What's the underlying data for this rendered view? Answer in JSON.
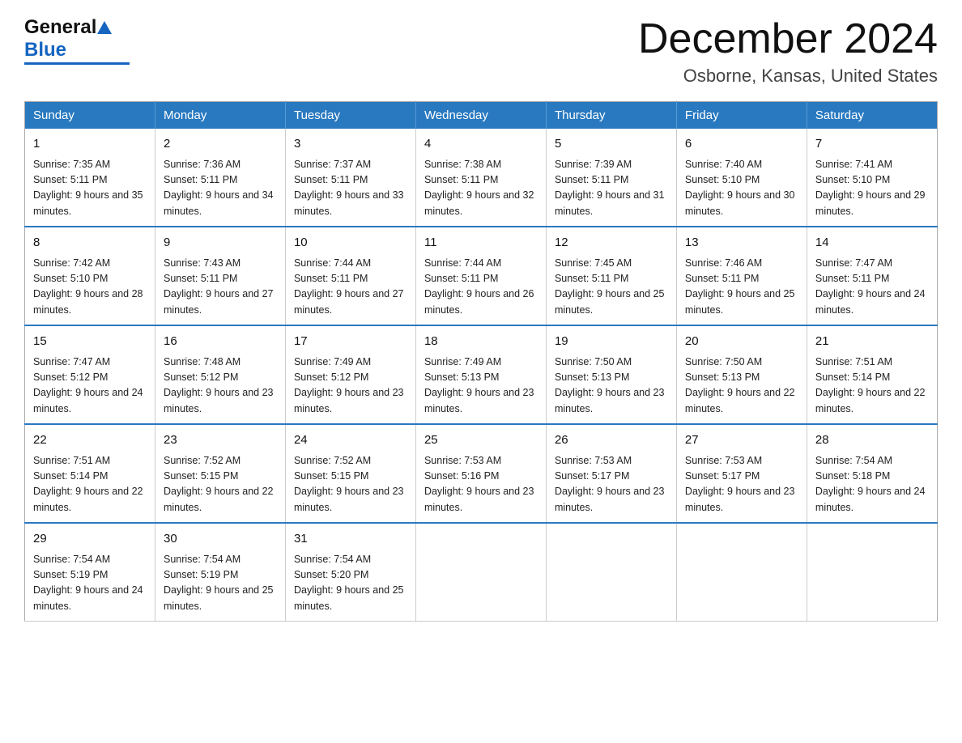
{
  "header": {
    "logo_general": "General",
    "logo_blue": "Blue",
    "month_title": "December 2024",
    "location": "Osborne, Kansas, United States"
  },
  "days_of_week": [
    "Sunday",
    "Monday",
    "Tuesday",
    "Wednesday",
    "Thursday",
    "Friday",
    "Saturday"
  ],
  "weeks": [
    [
      {
        "day": "1",
        "sunrise": "7:35 AM",
        "sunset": "5:11 PM",
        "daylight": "9 hours and 35 minutes."
      },
      {
        "day": "2",
        "sunrise": "7:36 AM",
        "sunset": "5:11 PM",
        "daylight": "9 hours and 34 minutes."
      },
      {
        "day": "3",
        "sunrise": "7:37 AM",
        "sunset": "5:11 PM",
        "daylight": "9 hours and 33 minutes."
      },
      {
        "day": "4",
        "sunrise": "7:38 AM",
        "sunset": "5:11 PM",
        "daylight": "9 hours and 32 minutes."
      },
      {
        "day": "5",
        "sunrise": "7:39 AM",
        "sunset": "5:11 PM",
        "daylight": "9 hours and 31 minutes."
      },
      {
        "day": "6",
        "sunrise": "7:40 AM",
        "sunset": "5:10 PM",
        "daylight": "9 hours and 30 minutes."
      },
      {
        "day": "7",
        "sunrise": "7:41 AM",
        "sunset": "5:10 PM",
        "daylight": "9 hours and 29 minutes."
      }
    ],
    [
      {
        "day": "8",
        "sunrise": "7:42 AM",
        "sunset": "5:10 PM",
        "daylight": "9 hours and 28 minutes."
      },
      {
        "day": "9",
        "sunrise": "7:43 AM",
        "sunset": "5:11 PM",
        "daylight": "9 hours and 27 minutes."
      },
      {
        "day": "10",
        "sunrise": "7:44 AM",
        "sunset": "5:11 PM",
        "daylight": "9 hours and 27 minutes."
      },
      {
        "day": "11",
        "sunrise": "7:44 AM",
        "sunset": "5:11 PM",
        "daylight": "9 hours and 26 minutes."
      },
      {
        "day": "12",
        "sunrise": "7:45 AM",
        "sunset": "5:11 PM",
        "daylight": "9 hours and 25 minutes."
      },
      {
        "day": "13",
        "sunrise": "7:46 AM",
        "sunset": "5:11 PM",
        "daylight": "9 hours and 25 minutes."
      },
      {
        "day": "14",
        "sunrise": "7:47 AM",
        "sunset": "5:11 PM",
        "daylight": "9 hours and 24 minutes."
      }
    ],
    [
      {
        "day": "15",
        "sunrise": "7:47 AM",
        "sunset": "5:12 PM",
        "daylight": "9 hours and 24 minutes."
      },
      {
        "day": "16",
        "sunrise": "7:48 AM",
        "sunset": "5:12 PM",
        "daylight": "9 hours and 23 minutes."
      },
      {
        "day": "17",
        "sunrise": "7:49 AM",
        "sunset": "5:12 PM",
        "daylight": "9 hours and 23 minutes."
      },
      {
        "day": "18",
        "sunrise": "7:49 AM",
        "sunset": "5:13 PM",
        "daylight": "9 hours and 23 minutes."
      },
      {
        "day": "19",
        "sunrise": "7:50 AM",
        "sunset": "5:13 PM",
        "daylight": "9 hours and 23 minutes."
      },
      {
        "day": "20",
        "sunrise": "7:50 AM",
        "sunset": "5:13 PM",
        "daylight": "9 hours and 22 minutes."
      },
      {
        "day": "21",
        "sunrise": "7:51 AM",
        "sunset": "5:14 PM",
        "daylight": "9 hours and 22 minutes."
      }
    ],
    [
      {
        "day": "22",
        "sunrise": "7:51 AM",
        "sunset": "5:14 PM",
        "daylight": "9 hours and 22 minutes."
      },
      {
        "day": "23",
        "sunrise": "7:52 AM",
        "sunset": "5:15 PM",
        "daylight": "9 hours and 22 minutes."
      },
      {
        "day": "24",
        "sunrise": "7:52 AM",
        "sunset": "5:15 PM",
        "daylight": "9 hours and 23 minutes."
      },
      {
        "day": "25",
        "sunrise": "7:53 AM",
        "sunset": "5:16 PM",
        "daylight": "9 hours and 23 minutes."
      },
      {
        "day": "26",
        "sunrise": "7:53 AM",
        "sunset": "5:17 PM",
        "daylight": "9 hours and 23 minutes."
      },
      {
        "day": "27",
        "sunrise": "7:53 AM",
        "sunset": "5:17 PM",
        "daylight": "9 hours and 23 minutes."
      },
      {
        "day": "28",
        "sunrise": "7:54 AM",
        "sunset": "5:18 PM",
        "daylight": "9 hours and 24 minutes."
      }
    ],
    [
      {
        "day": "29",
        "sunrise": "7:54 AM",
        "sunset": "5:19 PM",
        "daylight": "9 hours and 24 minutes."
      },
      {
        "day": "30",
        "sunrise": "7:54 AM",
        "sunset": "5:19 PM",
        "daylight": "9 hours and 25 minutes."
      },
      {
        "day": "31",
        "sunrise": "7:54 AM",
        "sunset": "5:20 PM",
        "daylight": "9 hours and 25 minutes."
      },
      null,
      null,
      null,
      null
    ]
  ]
}
